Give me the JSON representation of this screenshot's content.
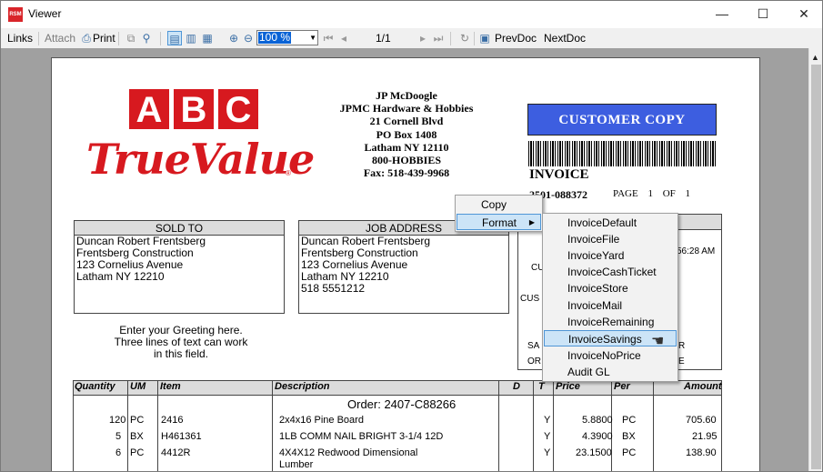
{
  "window": {
    "title": "Viewer",
    "minimize": "—",
    "maximize": "☐",
    "close": "✕",
    "app_badge": "RSM"
  },
  "toolbar": {
    "links": "Links",
    "attach": "Attach",
    "print": "Print",
    "zoom": "100 %",
    "page_indicator": "1/1",
    "prev_doc": "PrevDoc",
    "next_doc": "NextDoc"
  },
  "logo": {
    "letters": [
      "A",
      "B",
      "C"
    ],
    "brand": "TrueValue",
    "reg": "®"
  },
  "company": {
    "lines": [
      "JP McDoogle",
      "JPMC Hardware & Hobbies",
      "21 Cornell Blvd",
      "PO Box 1408",
      "Latham NY 12110",
      "800-HOBBIES",
      "Fax: 518-439-9968"
    ]
  },
  "copy_label": "CUSTOMER COPY",
  "invoice": {
    "title": "INVOICE",
    "number": "2501-088372",
    "page_label": "PAGE 1 OF 1"
  },
  "sold_to": {
    "header": "SOLD TO",
    "lines": [
      "Duncan Robert Frentsberg",
      "Frentsberg Construction",
      "123 Cornelius Avenue",
      "Latham NY 12210"
    ]
  },
  "job_address": {
    "header": "JOB ADDRESS",
    "lines": [
      "Duncan Robert Frentsberg",
      "Frentsberg Construction",
      "123 Cornelius Avenue",
      "Latham NY 12210",
      "518 5551212"
    ]
  },
  "greeting": [
    "Enter your Greeting here.",
    "Three lines of text can work",
    "in this field."
  ],
  "right_panel": {
    "time": "56:28 AM",
    "fragments": [
      "CU",
      "CUS",
      "SA",
      "OR",
      "R",
      "E"
    ]
  },
  "grid": {
    "headers": [
      "Quantity",
      "UM",
      "Item",
      "Description",
      "D",
      "T",
      "Price",
      "Per",
      "Amount"
    ],
    "order_label": "Order:  2407-C88266",
    "rows": [
      {
        "qty": "120",
        "um": "PC",
        "item": "2416",
        "desc": "2x4x16 Pine Board",
        "t": "Y",
        "price": "5.8800",
        "per": "PC",
        "amount": "705.60"
      },
      {
        "qty": "5",
        "um": "BX",
        "item": "H461361",
        "desc": "1LB COMM NAIL BRIGHT 3-1/4 12D",
        "t": "Y",
        "price": "4.3900",
        "per": "BX",
        "amount": "21.95"
      },
      {
        "qty": "6",
        "um": "PC",
        "item": "4412R",
        "desc": "4X4X12 Redwood Dimensional",
        "desc2": "Lumber",
        "t": "Y",
        "price": "23.1500",
        "per": "PC",
        "amount": "138.90"
      }
    ]
  },
  "context_menu": {
    "items": [
      "Copy",
      "Format"
    ]
  },
  "format_submenu": {
    "items": [
      "InvoiceDefault",
      "InvoiceFile",
      "InvoiceYard",
      "InvoiceCashTicket",
      "InvoiceStore",
      "InvoiceMail",
      "InvoiceRemaining",
      "InvoiceSavings",
      "InvoiceNoPrice",
      "Audit GL"
    ],
    "selected": "InvoiceSavings"
  }
}
